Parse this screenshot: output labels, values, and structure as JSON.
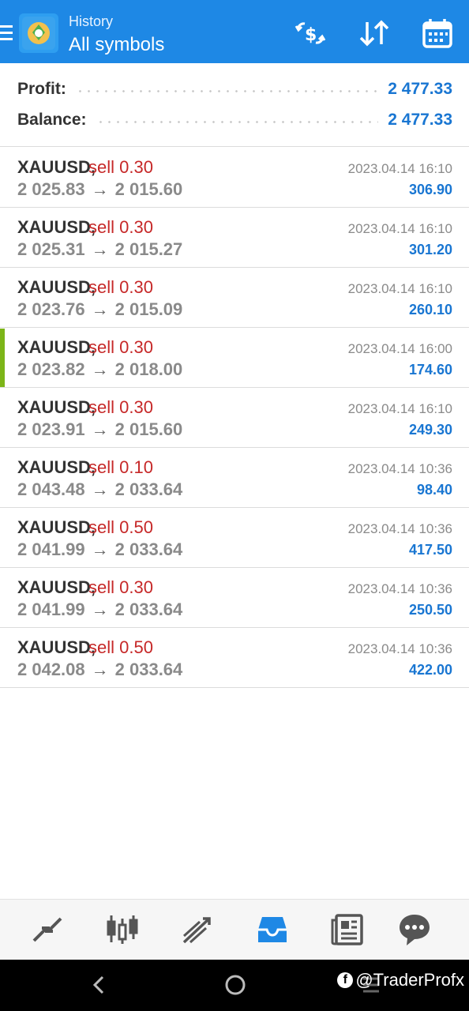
{
  "header": {
    "subtitle": "History",
    "title": "All symbols",
    "icons": [
      "menu-icon",
      "metatrader-logo",
      "currency-exchange-icon",
      "sort-icon",
      "calendar-icon"
    ]
  },
  "summary": {
    "profit_label": "Profit:",
    "profit_value": "2 477.33",
    "balance_label": "Balance:",
    "balance_value": "2 477.33"
  },
  "deals": [
    {
      "symbol": "XAUUSD,",
      "type": "sell 0.30",
      "open": "2 025.83",
      "close": "2 015.60",
      "time": "2023.04.14 16:10",
      "profit": "306.90"
    },
    {
      "symbol": "XAUUSD,",
      "type": "sell 0.30",
      "open": "2 025.31",
      "close": "2 015.27",
      "time": "2023.04.14 16:10",
      "profit": "301.20"
    },
    {
      "symbol": "XAUUSD,",
      "type": "sell 0.30",
      "open": "2 023.76",
      "close": "2 015.09",
      "time": "2023.04.14 16:10",
      "profit": "260.10"
    },
    {
      "symbol": "XAUUSD,",
      "type": "sell 0.30",
      "open": "2 023.82",
      "close": "2 018.00",
      "time": "2023.04.14 16:00",
      "profit": "174.60"
    },
    {
      "symbol": "XAUUSD,",
      "type": "sell 0.30",
      "open": "2 023.91",
      "close": "2 015.60",
      "time": "2023.04.14 16:10",
      "profit": "249.30"
    },
    {
      "symbol": "XAUUSD,",
      "type": "sell 0.10",
      "open": "2 043.48",
      "close": "2 033.64",
      "time": "2023.04.14 10:36",
      "profit": "98.40"
    },
    {
      "symbol": "XAUUSD,",
      "type": "sell 0.50",
      "open": "2 041.99",
      "close": "2 033.64",
      "time": "2023.04.14 10:36",
      "profit": "417.50"
    },
    {
      "symbol": "XAUUSD,",
      "type": "sell 0.30",
      "open": "2 041.99",
      "close": "2 033.64",
      "time": "2023.04.14 10:36",
      "profit": "250.50"
    },
    {
      "symbol": "XAUUSD,",
      "type": "sell 0.50",
      "open": "2 042.08",
      "close": "2 033.64",
      "time": "2023.04.14 10:36",
      "profit": "422.00"
    }
  ],
  "arrow": "→",
  "bottom_nav": {
    "items": [
      "quotes-icon",
      "chart-icon",
      "trade-icon",
      "history-icon",
      "news-icon",
      "messages-icon"
    ],
    "active": "history-icon"
  },
  "system_bar": {
    "icons": [
      "back-icon",
      "home-icon",
      "recents-icon"
    ],
    "watermark": "@TraderProfx"
  },
  "colors": {
    "header_bg": "#1e88e5",
    "sell": "#c62828",
    "profit": "#1976d2",
    "selected_marker": "#7cb518"
  }
}
